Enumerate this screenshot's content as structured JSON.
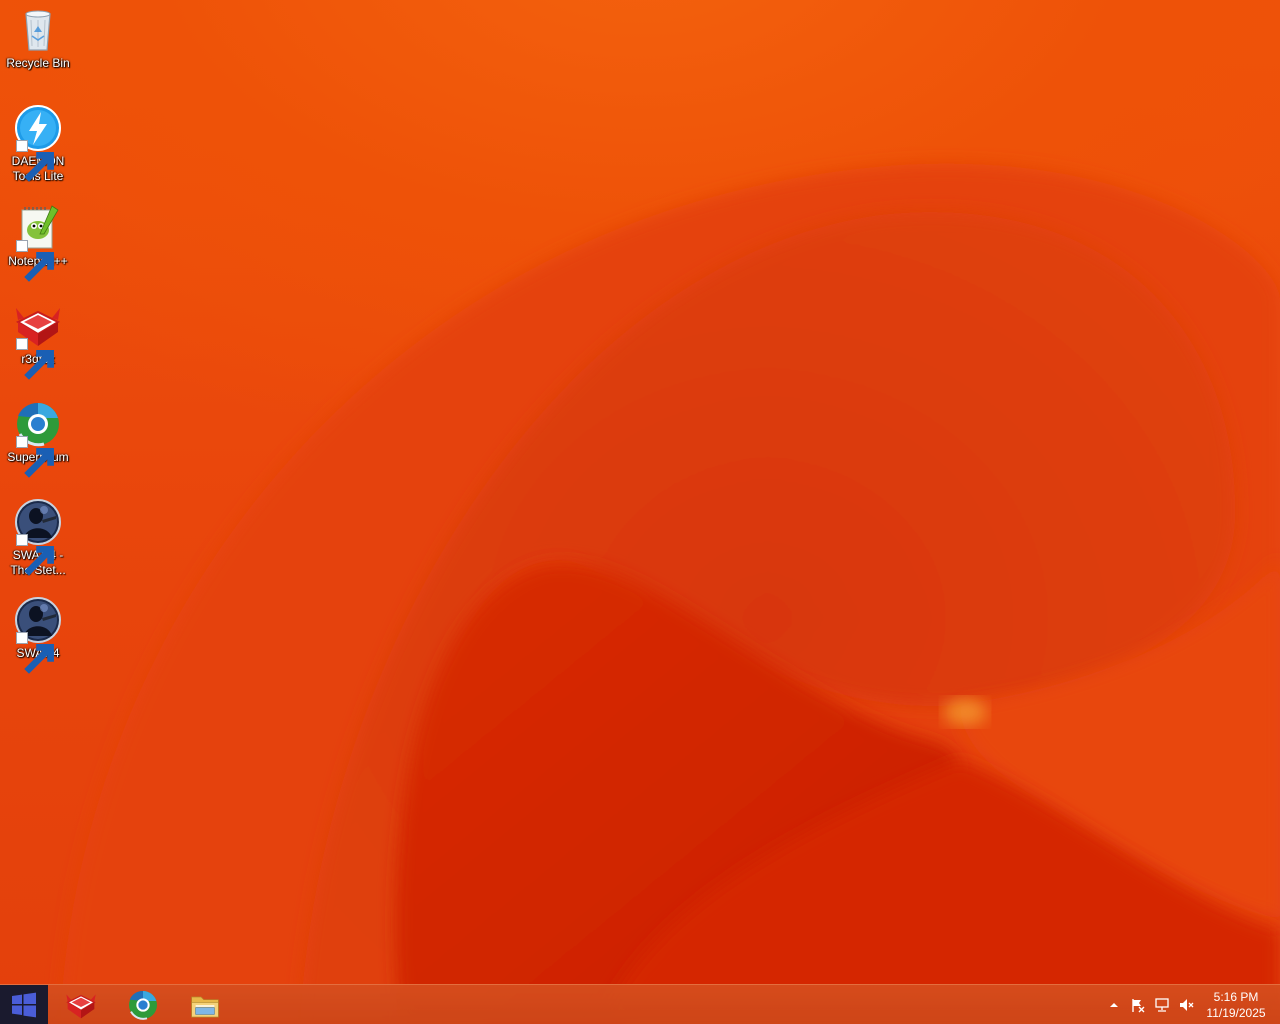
{
  "desktop": {
    "icons": [
      {
        "label": "Recycle Bin",
        "icon": "recycle-bin-icon"
      },
      {
        "label": "DAEMON\nTools Lite",
        "icon": "daemon-tools-icon"
      },
      {
        "label": "Notepad++",
        "icon": "notepad-plus-plus-icon"
      },
      {
        "label": "r3dfox",
        "icon": "r3dfox-icon"
      },
      {
        "label": "Supermium",
        "icon": "supermium-icon"
      },
      {
        "label": "SWAT 4 -\nThe Stet...",
        "icon": "swat4-stetchkov-icon"
      },
      {
        "label": "SWAT 4",
        "icon": "swat4-icon"
      }
    ]
  },
  "taskbar": {
    "start_icon": "windows-logo-icon",
    "pinned": [
      {
        "name": "r3dfox",
        "icon": "r3dfox-icon"
      },
      {
        "name": "Supermium",
        "icon": "supermium-icon"
      },
      {
        "name": "File Explorer",
        "icon": "file-explorer-icon"
      }
    ],
    "tray": {
      "icons": [
        "show-hidden-icons-chevron-icon",
        "action-center-flag-icon",
        "network-icon",
        "volume-muted-icon"
      ],
      "time": "5:16 PM",
      "date": "11/19/2025"
    }
  },
  "colors": {
    "wallpaper_base": "#e84a0c",
    "taskbar": "#d04a1c",
    "start_button": "#1a1a2e"
  }
}
